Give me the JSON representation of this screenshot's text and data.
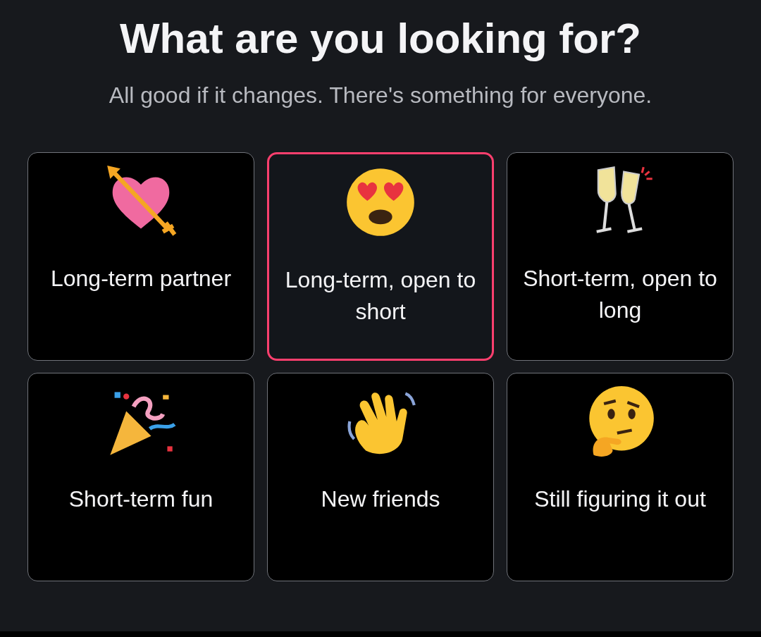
{
  "title": "What are you looking for?",
  "subtitle": "All good if it changes. There's something for everyone.",
  "options": [
    {
      "label": "Long-term partner",
      "selected": false
    },
    {
      "label": "Long-term, open to short",
      "selected": true
    },
    {
      "label": "Short-term, open to long",
      "selected": false
    },
    {
      "label": "Short-term fun",
      "selected": false
    },
    {
      "label": "New friends",
      "selected": false
    },
    {
      "label": "Still figuring it out",
      "selected": false
    }
  ]
}
